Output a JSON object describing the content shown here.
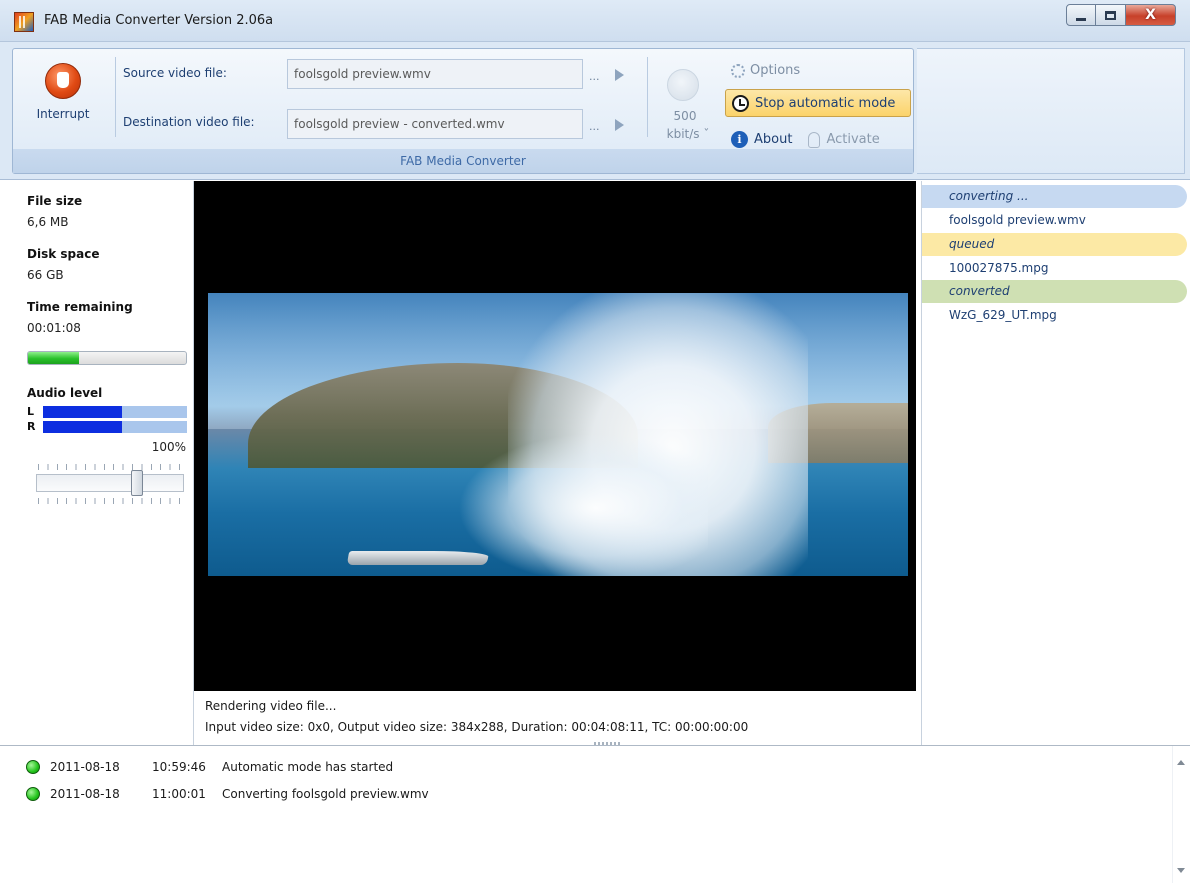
{
  "window": {
    "title": "FAB Media Converter Version 2.06a",
    "close_glyph": "X"
  },
  "ribbon": {
    "interrupt_label": "Interrupt",
    "source_label": "Source video file:",
    "source_value": "foolsgold preview.wmv",
    "destination_label": "Destination video file:",
    "destination_value": "foolsgold preview - converted.wmv",
    "browse_label": "...",
    "bitrate_value": "500",
    "bitrate_unit": "kbit/s ˇ",
    "options_label": "Options",
    "stop_label": "Stop automatic mode",
    "about_label": "About",
    "activate_label": "Activate",
    "group_label": "FAB Media Converter"
  },
  "stats": {
    "file_size_label": "File size",
    "file_size_value": "6,6 MB",
    "disk_space_label": "Disk space",
    "disk_space_value": "66 GB",
    "time_remaining_label": "Time remaining",
    "time_remaining_value": "00:01:08",
    "progress_fraction": 0.32,
    "audio_level_label": "Audio level",
    "left_channel": "L",
    "right_channel": "R",
    "left_level_fraction": 0.55,
    "right_level_fraction": 0.55,
    "volume_percent": "100%",
    "volume_fraction": 0.7
  },
  "status": {
    "line1": "Rendering video file...",
    "line2": "Input video size: 0x0, Output video size: 384x288, Duration: 00:04:08:11, TC: 00:00:00:00"
  },
  "queue": {
    "converting_label": "converting ...",
    "converting_file": "foolsgold preview.wmv",
    "queued_label": "queued",
    "queued_file": "100027875.mpg",
    "converted_label": "converted",
    "converted_file": "WzG_629_UT.mpg"
  },
  "log": [
    {
      "date": "2011-08-18",
      "time": "10:59:46",
      "message": "Automatic mode has started"
    },
    {
      "date": "2011-08-18",
      "time": "11:00:01",
      "message": "Converting foolsgold preview.wmv"
    }
  ],
  "colors": {
    "accent": "#1e3f72",
    "progress_green": "#29c12a",
    "audio_blue": "#0d2ee0",
    "stop_button": "#fbd36a"
  }
}
